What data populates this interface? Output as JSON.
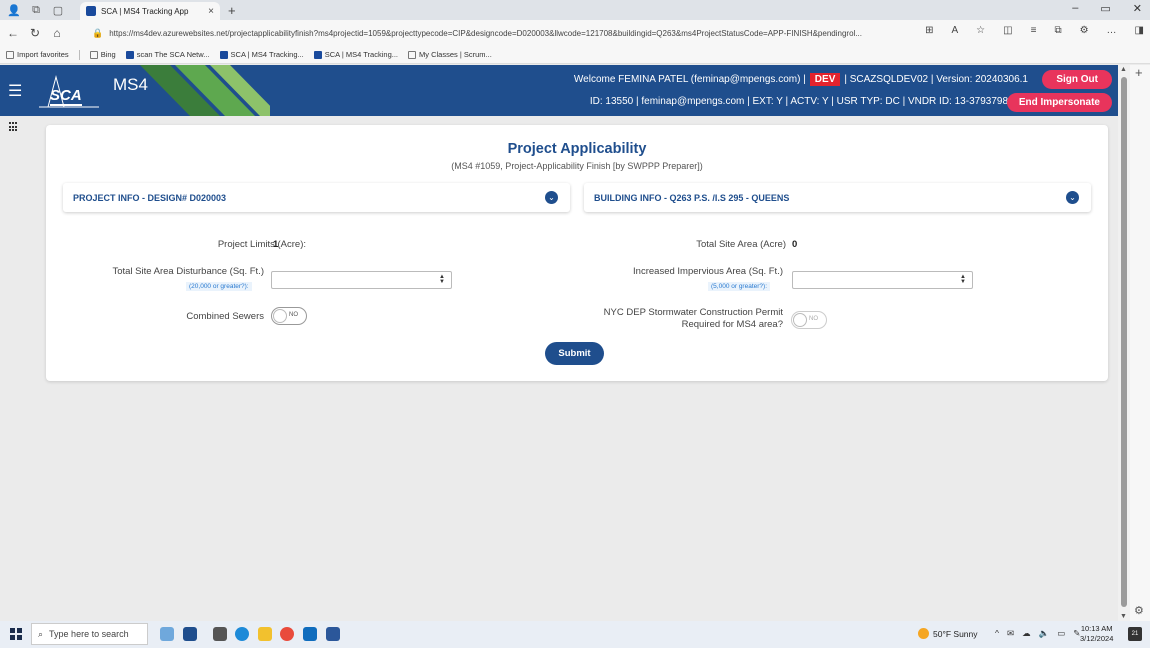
{
  "browser": {
    "tab_title": "SCA | MS4 Tracking App",
    "url": "https://ms4dev.azurewebsites.net/projectapplicabilityfinish?ms4projectid=1059&projecttypecode=CIP&designcode=D020003&llwcode=121708&buildingid=Q263&ms4ProjectStatusCode=APP-FINISH&pendingrol...",
    "favorites": [
      "Import favorites",
      "Bing",
      "scan The SCA Netw...",
      "SCA | MS4 Tracking...",
      "SCA | MS4 Tracking...",
      "My Classes | Scrum..."
    ]
  },
  "header": {
    "app_name": "MS4",
    "logo_text": "SCA",
    "welcome": "Welcome FEMINA PATEL (feminap@mpengs.com) |",
    "env_badge": "DEV",
    "server_info": "| SCAZSQLDEV02 | Version: 20240306.1",
    "user_info": "ID: 13550 | feminap@mpengs.com | EXT: Y | ACTV: Y | USR TYP: DC | VNDR ID: 13-3793798",
    "sign_out_label": "Sign Out",
    "end_impersonate_label": "End Impersonate",
    "colors": {
      "header_bg": "#1f4e8d",
      "accent_button": "#e8345c",
      "dev_badge": "#e3232d"
    }
  },
  "page": {
    "title": "Project Applicability",
    "subtitle": "(MS4 #1059, Project-Applicability Finish [by SWPPP Preparer])",
    "project_panel_title": "PROJECT INFO - DESIGN# D020003",
    "building_panel_title": "BUILDING INFO - Q263 P.S. /I.S 295 - QUEENS"
  },
  "form": {
    "project_limits_label": "Project Limits (Acre):",
    "project_limits_value": "1",
    "total_site_area_label": "Total Site Area (Acre)",
    "total_site_area_value": "0",
    "disturbance_label": "Total Site Area Disturbance (Sq. Ft.)",
    "disturbance_hint": "(20,000 or greater?):",
    "disturbance_value": "",
    "impervious_label": "Increased Impervious Area (Sq. Ft.)",
    "impervious_hint": "(5,000 or greater?):",
    "impervious_value": "",
    "combined_sewers_label": "Combined Sewers",
    "combined_sewers_value": "NO",
    "nycdep_label_line1": "NYC DEP Stormwater Construction Permit",
    "nycdep_label_line2": "Required for MS4 area?",
    "nycdep_value": "NO",
    "submit_label": "Submit"
  },
  "taskbar": {
    "search_placeholder": "Type here to search",
    "weather": "50°F  Sunny",
    "time": "10:13 AM",
    "date": "3/12/2024",
    "notification_count": "21"
  }
}
